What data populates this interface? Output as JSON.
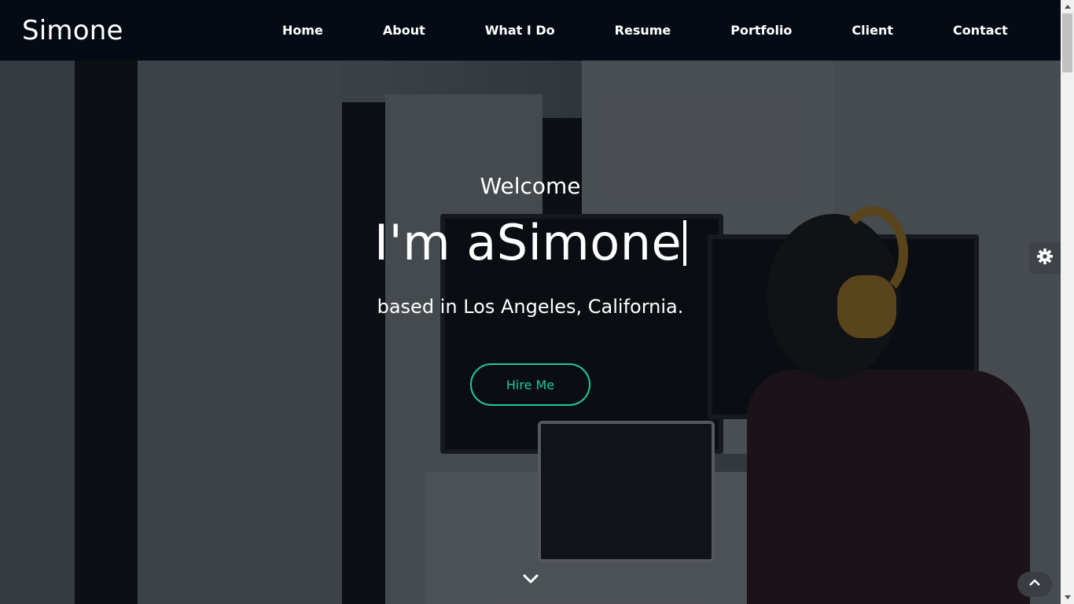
{
  "brand": {
    "name": "Simone"
  },
  "nav": {
    "items": [
      {
        "label": "Home"
      },
      {
        "label": "About"
      },
      {
        "label": "What I Do"
      },
      {
        "label": "Resume"
      },
      {
        "label": "Portfolio"
      },
      {
        "label": "Client"
      },
      {
        "label": "Contact"
      }
    ]
  },
  "hero": {
    "welcome": "Welcome",
    "headline": "I'm aSimone",
    "location": "based in Los Angeles, California.",
    "cta_label": "Hire Me"
  },
  "icons": {
    "settings": "gear-icon",
    "scroll_down": "chevron-down-icon",
    "back_to_top": "chevron-up-icon"
  },
  "colors": {
    "navbar_bg": "#050b14",
    "accent": "#20c997",
    "text": "#ffffff"
  }
}
